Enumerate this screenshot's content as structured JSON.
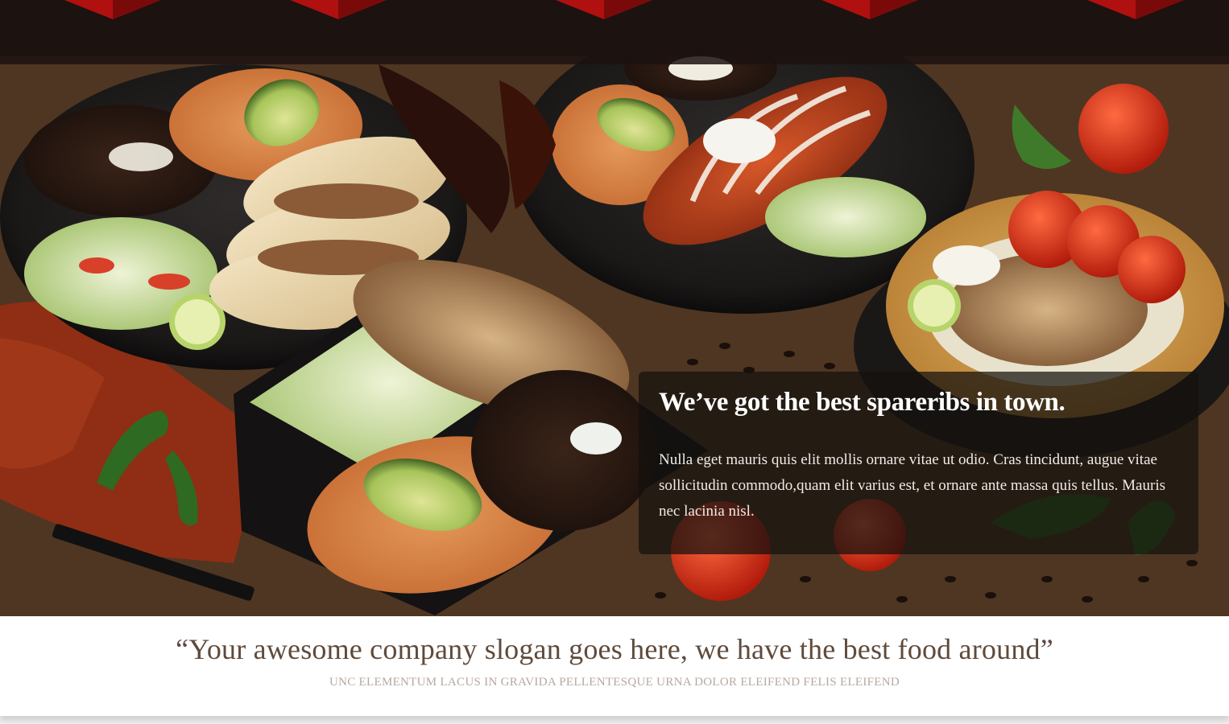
{
  "hero": {
    "image_icon": "food-platter-photo",
    "caption": {
      "title": "We’ve got the best spareribs in town.",
      "body": "Nulla eget mauris quis elit mollis ornare vitae ut odio. Cras tincidunt, augue vitae sollicitudin commodo,quam elit varius est, et ornare ante massa quis tellus. Mauris nec lacinia nisl."
    }
  },
  "slogan": {
    "headline": "“Your awesome company slogan goes here, we have the best food around”",
    "subline": "UNC ELEMENTUM LACUS IN GRAVIDA PELLENTESQUE URNA DOLOR ELEIFEND FELIS ELEIFEND"
  },
  "colors": {
    "band": "#1c1210",
    "accent_red": "#b01010",
    "slogan_text": "#5f4a3c",
    "subline_text": "#b7a8a0"
  }
}
